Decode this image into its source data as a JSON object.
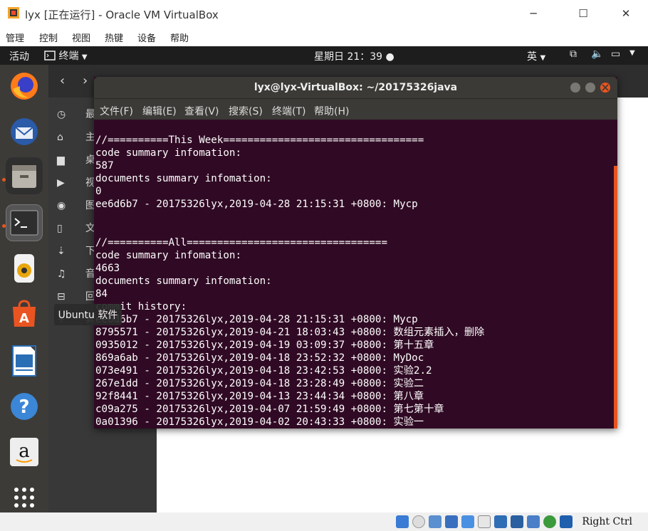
{
  "vbox": {
    "title": "lyx [正在运行] - Oracle VM VirtualBox",
    "menu": [
      "管理",
      "控制",
      "视图",
      "热键",
      "设备",
      "帮助"
    ],
    "host_key": "Right Ctrl"
  },
  "topbar": {
    "activities": "活动",
    "app_menu": "终端",
    "clock": "星期日 21：39",
    "input_method": "英"
  },
  "dock": {
    "items": [
      "firefox-icon",
      "thunderbird-icon",
      "files-icon",
      "terminal-icon",
      "rhythmbox-icon",
      "ubuntu-software-icon",
      "libreoffice-writer-icon",
      "help-icon",
      "amazon-icon",
      "show-apps-icon"
    ],
    "tooltip": "Ubuntu 软件"
  },
  "files": {
    "sidebar_labels": [
      "最",
      "主",
      "桌",
      "视",
      "图",
      "文",
      "下",
      "音",
      "回",
      "其"
    ]
  },
  "terminal": {
    "title": "lyx@lyx-VirtualBox: ~/20175326java",
    "menu": [
      "文件(F)",
      "编辑(E)",
      "查看(V)",
      "搜索(S)",
      "终端(T)",
      "帮助(H)"
    ],
    "lines": [
      "//==========This Week=================================",
      "code summary infomation:",
      "587",
      "documents summary infomation:",
      "0",
      "ee6d6b7 - 20175326lyx,2019-04-28 21:15:31 +0800: Mycp",
      "",
      "",
      "//==========All=================================",
      "code summary infomation:",
      "4663",
      "documents summary infomation:",
      "84",
      "commit history:",
      "ee6d6b7 - 20175326lyx,2019-04-28 21:15:31 +0800: Mycp",
      "8795571 - 20175326lyx,2019-04-21 18:03:43 +0800: 数组元素插入，删除",
      "0935012 - 20175326lyx,2019-04-19 03:09:37 +0800: 第十五章",
      "869a6ab - 20175326lyx,2019-04-18 23:52:32 +0800: MyDoc",
      "073e491 - 20175326lyx,2019-04-18 23:42:53 +0800: 实验2.2",
      "267e1dd - 20175326lyx,2019-04-18 23:28:49 +0800: 实验二",
      "92f8441 - 20175326lyx,2019-04-13 23:44:34 +0800: 第八章",
      "c09a275 - 20175326lyx,2019-04-07 21:59:49 +0800: 第七第十章",
      "0a01396 - 20175326lyx,2019-04-02 20:43:33 +0800: 实验一"
    ]
  }
}
